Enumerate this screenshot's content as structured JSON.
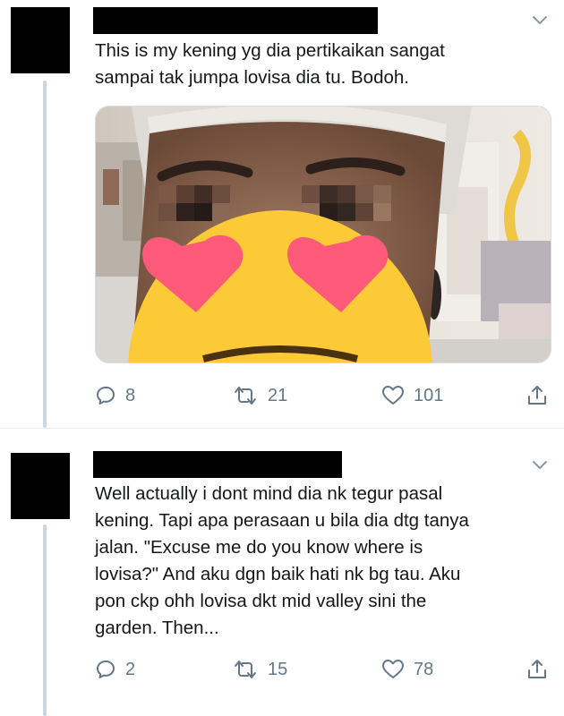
{
  "tweets": [
    {
      "text": "This is my kening yg dia pertikaikan sangat\nsampai tak jumpa lovisa dia tu. Bodoh.",
      "has_media": true,
      "actions": {
        "replies": "8",
        "retweets": "21",
        "likes": "101"
      },
      "icons": [
        "reply-icon",
        "retweet-icon",
        "like-icon",
        "share-icon",
        "chevron-down-icon"
      ]
    },
    {
      "text": "Well actually i dont mind dia nk tegur pasal\nkening. Tapi apa perasaan u bila dia dtg tanya\njalan. \"Excuse me do you know where is\nlovisa?\" And aku dgn baik hati nk bg tau. Aku\npon ckp ohh lovisa dkt mid valley sini the\ngarden. Then...",
      "has_media": false,
      "actions": {
        "replies": "2",
        "retweets": "15",
        "likes": "78"
      },
      "icons": [
        "reply-icon",
        "retweet-icon",
        "like-icon",
        "share-icon",
        "chevron-down-icon"
      ]
    }
  ],
  "colors": {
    "icon_gray": "#657786",
    "text": "#14171a",
    "thread_line": "#cdd6dd",
    "heart_pink": "#ff5a7a",
    "emoji_yellow": "#fcc937"
  }
}
